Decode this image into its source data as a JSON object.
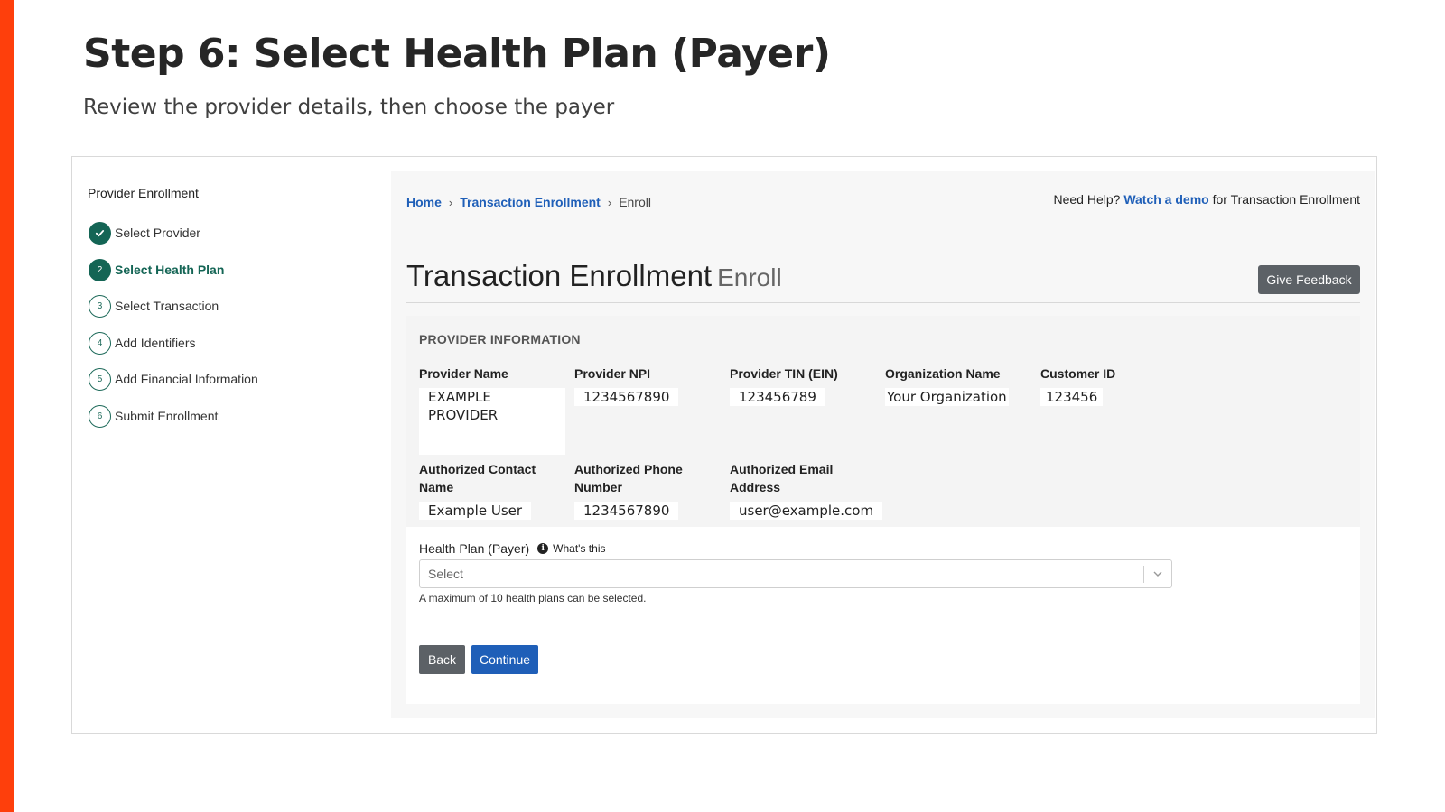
{
  "slide": {
    "title": "Step 6: Select Health Plan (Payer)",
    "subtitle": "Review the provider details, then choose the payer",
    "accent_color": "#fe3f0c"
  },
  "sidebar": {
    "title": "Provider Enrollment",
    "steps": [
      {
        "marker": "",
        "label": "Select Provider",
        "state": "completed"
      },
      {
        "marker": "2",
        "label": "Select Health Plan",
        "state": "current"
      },
      {
        "marker": "3",
        "label": "Select Transaction",
        "state": "upcoming"
      },
      {
        "marker": "4",
        "label": "Add Identifiers",
        "state": "upcoming"
      },
      {
        "marker": "5",
        "label": "Add Financial Information",
        "state": "upcoming"
      },
      {
        "marker": "6",
        "label": "Submit Enrollment",
        "state": "upcoming"
      }
    ]
  },
  "breadcrumb": {
    "items": [
      "Home",
      "Transaction Enrollment",
      "Enroll"
    ]
  },
  "help": {
    "prefix": "Need Help?",
    "link": "Watch a demo",
    "suffix": "for Transaction Enrollment"
  },
  "page": {
    "heading": "Transaction Enrollment",
    "subheading": "Enroll",
    "feedback_label": "Give Feedback"
  },
  "provider_info": {
    "section_title": "PROVIDER INFORMATION",
    "fields": [
      {
        "label": "Provider Name",
        "value": "EXAMPLE PROVIDER"
      },
      {
        "label": "Provider NPI",
        "value": "1234567890"
      },
      {
        "label": "Provider TIN (EIN)",
        "value": "123456789"
      },
      {
        "label": "Organization Name",
        "value": "Your Organization"
      },
      {
        "label": "Customer ID",
        "value": "123456"
      },
      {
        "label": "Authorized Contact Name",
        "value": "Example User"
      },
      {
        "label": "Authorized Phone Number",
        "value": "1234567890"
      },
      {
        "label": "Authorized Email Address",
        "value": "user@example.com"
      }
    ]
  },
  "payer": {
    "label": "Health Plan (Payer)",
    "info_icon": "info-icon",
    "whats_this": "What's this",
    "placeholder": "Select",
    "helper": "A maximum of 10 health plans can be selected."
  },
  "actions": {
    "back_label": "Back",
    "continue_label": "Continue"
  },
  "colors": {
    "step_green": "#146555",
    "link_blue": "#1f5fb8",
    "button_gray": "#5c6166"
  }
}
